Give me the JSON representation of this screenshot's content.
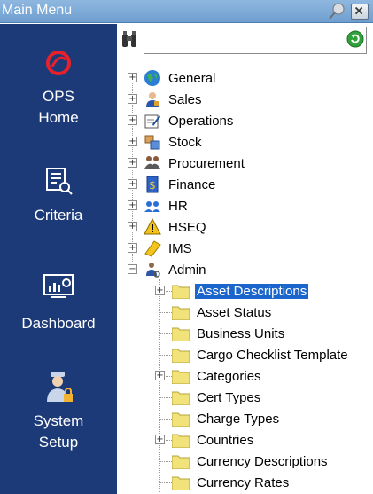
{
  "window": {
    "title": "Main Menu"
  },
  "sidebar": {
    "items": [
      {
        "label": "OPS Home",
        "icon": "ops-logo-icon"
      },
      {
        "label": "Criteria",
        "icon": "criteria-icon"
      },
      {
        "label": "Dashboard",
        "icon": "dashboard-icon"
      },
      {
        "label": "System Setup",
        "icon": "system-setup-icon"
      }
    ]
  },
  "search": {
    "value": ""
  },
  "tree": {
    "top": [
      {
        "label": "General",
        "icon": "globe-icon"
      },
      {
        "label": "Sales",
        "icon": "sales-person-icon"
      },
      {
        "label": "Operations",
        "icon": "operations-icon"
      },
      {
        "label": "Stock",
        "icon": "stock-icon"
      },
      {
        "label": "Procurement",
        "icon": "procurement-icon"
      },
      {
        "label": "Finance",
        "icon": "finance-icon"
      },
      {
        "label": "HR",
        "icon": "hr-people-icon"
      },
      {
        "label": "HSEQ",
        "icon": "warning-icon"
      },
      {
        "label": "IMS",
        "icon": "ims-icon"
      },
      {
        "label": "Admin",
        "icon": "admin-icon"
      }
    ],
    "admin_children": [
      {
        "label": "Asset Descriptions",
        "expandable": true,
        "selected": true
      },
      {
        "label": "Asset Status",
        "expandable": false
      },
      {
        "label": "Business Units",
        "expandable": false
      },
      {
        "label": "Cargo Checklist Template",
        "expandable": false
      },
      {
        "label": "Categories",
        "expandable": true
      },
      {
        "label": "Cert Types",
        "expandable": false
      },
      {
        "label": "Charge Types",
        "expandable": false
      },
      {
        "label": "Countries",
        "expandable": true
      },
      {
        "label": "Currency Descriptions",
        "expandable": false
      },
      {
        "label": "Currency Rates",
        "expandable": false
      }
    ]
  }
}
